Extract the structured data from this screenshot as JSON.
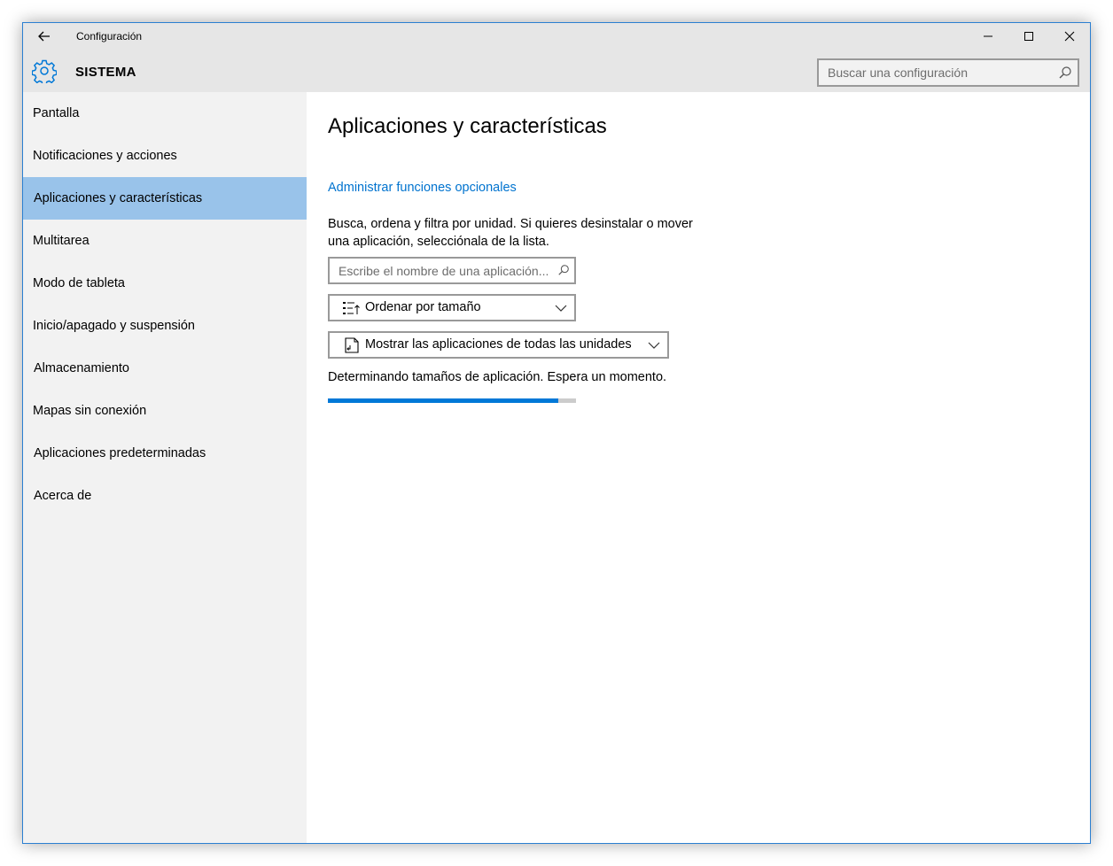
{
  "window": {
    "title": "Configuración"
  },
  "header": {
    "section_title": "SISTEMA",
    "search_placeholder": "Buscar una configuración",
    "icon": "gear-icon"
  },
  "sidebar": {
    "items": [
      {
        "label": "Pantalla",
        "selected": false
      },
      {
        "label": "Notificaciones y acciones",
        "selected": false
      },
      {
        "label": "Aplicaciones y características",
        "selected": true
      },
      {
        "label": "Multitarea",
        "selected": false
      },
      {
        "label": "Modo de tableta",
        "selected": false
      },
      {
        "label": "Inicio/apagado y suspensión",
        "selected": false
      },
      {
        "label": "Almacenamiento",
        "selected": false
      },
      {
        "label": "Mapas sin conexión",
        "selected": false
      },
      {
        "label": "Aplicaciones predeterminadas",
        "selected": false
      },
      {
        "label": "Acerca de",
        "selected": false
      }
    ]
  },
  "main": {
    "title": "Aplicaciones y características",
    "optional_features_link": "Administrar funciones opcionales",
    "description": "Busca, ordena y filtra por unidad. Si quieres desinstalar o mover una aplicación, selecciónala de la lista.",
    "app_search_placeholder": "Escribe el nombre de una aplicación...",
    "sort_dropdown": {
      "selected": "Ordenar por tamaño"
    },
    "drives_dropdown": {
      "selected": "Mostrar las aplicaciones de todas las unidades"
    },
    "status": "Determinando tamaños de aplicación. Espera un momento.",
    "progress": 0.93
  },
  "colors": {
    "accent": "#0078d7",
    "link": "#0073cf",
    "selected_nav": "#99c3ea",
    "chrome": "#e6e6e6",
    "sidebar_bg": "#f2f2f2",
    "window_border": "#2b7fd1"
  }
}
